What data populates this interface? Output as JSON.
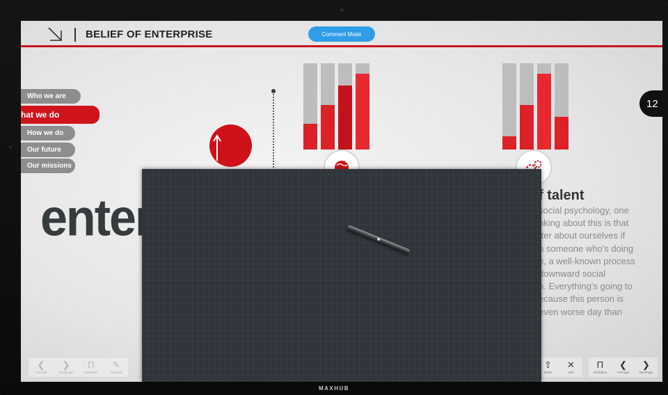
{
  "device": {
    "brand": "MAXHUB"
  },
  "header": {
    "title": "BELIEF OF ENTERPRISE",
    "comment_mode_label": "Comment Mode"
  },
  "sidebar": {
    "items": [
      {
        "label": "Who we are",
        "active": false
      },
      {
        "label": "hat we do",
        "active": true
      },
      {
        "label": "How we do",
        "active": false
      },
      {
        "label": "Our future",
        "active": false
      },
      {
        "label": "Our missions",
        "active": false
      }
    ]
  },
  "slide": {
    "big_word": "enter",
    "talent_title": "f talent",
    "talent_lines": [
      "social psychology, one",
      "nking about this is that",
      "tter about ourselves if",
      "n someone who's doing",
      "e, a well-known process",
      "downward social",
      "n. Everything's going to",
      "ecause this person is",
      "even worse day than"
    ],
    "page_number": "12",
    "icons": [
      "arrow-up-icon",
      "globe-icon",
      "gears-icon"
    ]
  },
  "chart_data": [
    {
      "type": "bar",
      "values": [
        0.3,
        0.52,
        0.74,
        0.88
      ]
    },
    {
      "type": "bar",
      "values": [
        0.15,
        0.52,
        0.88,
        0.38
      ]
    }
  ],
  "toolbar_left": {
    "items": [
      {
        "icon": "chevron-left-icon",
        "label": "PrePage"
      },
      {
        "icon": "chevron-right-icon",
        "label": "NextPage"
      },
      {
        "icon": "exhibition-icon",
        "label": "Exhibition"
      },
      {
        "icon": "pen-icon",
        "label": "Annotate"
      }
    ]
  },
  "toolbar_right": {
    "items": [
      {
        "icon": "share-icon",
        "label": "Share"
      },
      {
        "icon": "close-icon",
        "label": "Exit"
      },
      {
        "icon": "exhibition-icon",
        "label": "Exhibition"
      },
      {
        "icon": "chevron-left-icon",
        "label": "PrePage"
      },
      {
        "icon": "chevron-right-icon",
        "label": "NextPage"
      }
    ]
  },
  "colors": {
    "accent_red": "#c8141b",
    "bright_red": "#e8282f",
    "comment_blue": "#2f9de8",
    "overlay": "#30343b"
  }
}
